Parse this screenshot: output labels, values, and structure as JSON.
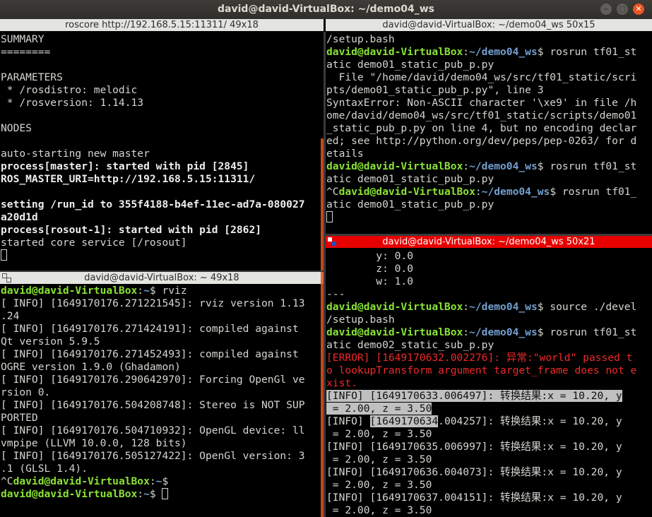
{
  "window": {
    "title": "david@david-VirtualBox: ~/demo04_ws"
  },
  "pane_tl": {
    "title": "roscore http://192.168.5.15:11311/ 49x18",
    "lines": [
      [
        {
          "t": "SUMMARY"
        }
      ],
      [
        {
          "t": "========"
        }
      ],
      [
        {
          "t": ""
        }
      ],
      [
        {
          "t": "PARAMETERS"
        }
      ],
      [
        {
          "t": " * /rosdistro: melodic"
        }
      ],
      [
        {
          "t": " * /rosversion: 1.14.13"
        }
      ],
      [
        {
          "t": ""
        }
      ],
      [
        {
          "t": "NODES"
        }
      ],
      [
        {
          "t": ""
        }
      ],
      [
        {
          "t": "auto-starting new master"
        }
      ],
      [
        {
          "t": "process[master]: started with pid [2845]",
          "c": "b"
        }
      ],
      [
        {
          "t": "ROS_MASTER_URI=http://192.168.5.15:11311/",
          "c": "b"
        }
      ],
      [
        {
          "t": ""
        }
      ],
      [
        {
          "t": "setting /run_id to 355f4188-b4ef-11ec-ad7a-080027",
          "c": "b"
        }
      ],
      [
        {
          "t": "a20d1d",
          "c": "b"
        }
      ],
      [
        {
          "t": "process[rosout-1]: started with pid [2862]",
          "c": "b"
        }
      ],
      [
        {
          "t": "started core service [/rosout]"
        }
      ],
      [
        {
          "cursor": true
        }
      ]
    ]
  },
  "pane_bl": {
    "title": "david@david-VirtualBox: ~ 49x18",
    "lines": [
      [
        {
          "t": "david@david-VirtualBox",
          "c": "g"
        },
        {
          "t": ":"
        },
        {
          "t": "~",
          "c": "bl"
        },
        {
          "t": "$ rviz"
        }
      ],
      [
        {
          "t": "[ INFO] [1649170176.271221545]: rviz version 1.13"
        }
      ],
      [
        {
          "t": ".24"
        }
      ],
      [
        {
          "t": "[ INFO] [1649170176.271424191]: compiled against"
        }
      ],
      [
        {
          "t": "Qt version 5.9.5"
        }
      ],
      [
        {
          "t": "[ INFO] [1649170176.271452493]: compiled against"
        }
      ],
      [
        {
          "t": "OGRE version 1.9.0 (Ghadamon)"
        }
      ],
      [
        {
          "t": "[ INFO] [1649170176.290642970]: Forcing OpenGl ve"
        }
      ],
      [
        {
          "t": "rsion 0."
        }
      ],
      [
        {
          "t": "[ INFO] [1649170176.504208748]: Stereo is NOT SUP"
        }
      ],
      [
        {
          "t": "PORTED"
        }
      ],
      [
        {
          "t": "[ INFO] [1649170176.504710932]: OpenGL device: ll"
        }
      ],
      [
        {
          "t": "vmpipe (LLVM 10.0.0, 128 bits)"
        }
      ],
      [
        {
          "t": "[ INFO] [1649170176.505127422]: OpenGl version: 3"
        }
      ],
      [
        {
          "t": ".1 (GLSL 1.4)."
        }
      ],
      [
        {
          "t": "^C"
        },
        {
          "t": "david@david-VirtualBox",
          "c": "g"
        },
        {
          "t": ":"
        },
        {
          "t": "~",
          "c": "bl"
        },
        {
          "t": "$"
        }
      ],
      [
        {
          "t": "david@david-VirtualBox",
          "c": "g"
        },
        {
          "t": ":"
        },
        {
          "t": "~",
          "c": "bl"
        },
        {
          "t": "$ "
        },
        {
          "cursor": true
        }
      ]
    ]
  },
  "pane_tr": {
    "title": "david@david-VirtualBox: ~/demo04_ws 50x15",
    "lines": [
      [
        {
          "t": "/setup.bash"
        }
      ],
      [
        {
          "t": "david@david-VirtualBox",
          "c": "g"
        },
        {
          "t": ":"
        },
        {
          "t": "~/demo04_ws",
          "c": "bl"
        },
        {
          "t": "$ rosrun tf01_st"
        }
      ],
      [
        {
          "t": "atic demo01_static_pub_p.py"
        }
      ],
      [
        {
          "t": "  File \"/home/david/demo04_ws/src/tf01_static/scri"
        }
      ],
      [
        {
          "t": "pts/demo01_static_pub_p.py\", line 3"
        }
      ],
      [
        {
          "t": "SyntaxError: Non-ASCII character '\\xe9' in file /h"
        }
      ],
      [
        {
          "t": "ome/david/demo04_ws/src/tf01_static/scripts/demo01"
        }
      ],
      [
        {
          "t": "_static_pub_p.py on line 4, but no encoding declar"
        }
      ],
      [
        {
          "t": "ed; see http://python.org/dev/peps/pep-0263/ for d"
        }
      ],
      [
        {
          "t": "etails"
        }
      ],
      [
        {
          "t": "david@david-VirtualBox",
          "c": "g"
        },
        {
          "t": ":"
        },
        {
          "t": "~/demo04_ws",
          "c": "bl"
        },
        {
          "t": "$ rosrun tf01_st"
        }
      ],
      [
        {
          "t": "atic demo01_static_pub_p.py"
        }
      ],
      [
        {
          "t": "^C"
        },
        {
          "t": "david@david-VirtualBox",
          "c": "g"
        },
        {
          "t": ":"
        },
        {
          "t": "~/demo04_ws",
          "c": "bl"
        },
        {
          "t": "$ rosrun tf01_"
        }
      ],
      [
        {
          "t": "atic demo01_static_pub_p.py"
        }
      ],
      [
        {
          "cursor": true
        }
      ]
    ]
  },
  "pane_br": {
    "title": "david@david-VirtualBox: ~/demo04_ws 50x21",
    "lines": [
      [
        {
          "t": "        y: 0.0"
        }
      ],
      [
        {
          "t": "        z: 0.0"
        }
      ],
      [
        {
          "t": "        w: 1.0"
        }
      ],
      [
        {
          "t": "---"
        }
      ],
      [
        {
          "t": "david@david-VirtualBox",
          "c": "g"
        },
        {
          "t": ":"
        },
        {
          "t": "~/demo04_ws",
          "c": "bl"
        },
        {
          "t": "$ source ./devel"
        }
      ],
      [
        {
          "t": "/setup.bash"
        }
      ],
      [
        {
          "t": "david@david-VirtualBox",
          "c": "g"
        },
        {
          "t": ":"
        },
        {
          "t": "~/demo04_ws",
          "c": "bl"
        },
        {
          "t": "$ rosrun tf01_st"
        }
      ],
      [
        {
          "t": "atic demo02_static_sub_p.py"
        }
      ],
      [
        {
          "t": "[ERROR] [1649170632.002276]: 异常:\"world\" passed t",
          "c": "r"
        }
      ],
      [
        {
          "t": "o lookupTransform argument target_frame does not e",
          "c": "r"
        }
      ],
      [
        {
          "t": "xist.",
          "c": "r"
        }
      ],
      [
        {
          "t": "[INFO] [1649170633.006497]: 转换结果:x = 10.20, y",
          "c": "hl"
        }
      ],
      [
        {
          "t": " = 2.00, z = 3.50",
          "c": "hl"
        }
      ],
      [
        {
          "t": "[INFO] "
        },
        {
          "t": "[1649170634",
          "c": "hl"
        },
        {
          "t": ".004257]: 转换结果:x = 10.20, y"
        }
      ],
      [
        {
          "t": " = 2.00, z = 3.50"
        }
      ],
      [
        {
          "t": "[INFO] [1649170635.006997]: 转换结果:x = 10.20, y"
        }
      ],
      [
        {
          "t": " = 2.00, z = 3.50"
        }
      ],
      [
        {
          "t": "[INFO] [1649170636.004073]: 转换结果:x = 10.20, y"
        }
      ],
      [
        {
          "t": " = 2.00, z = 3.50"
        }
      ],
      [
        {
          "t": "[INFO] [1649170637.004151]: 转换结果:x = 10.20, y"
        }
      ],
      [
        {
          "t": " = 2.00, z = 3.50"
        }
      ]
    ]
  },
  "colors": {
    "prompt_user": "#8ae234",
    "prompt_path": "#729fcf",
    "error": "#ef2929",
    "active_pane_title": "#e60000",
    "close_button": "#e95420"
  }
}
